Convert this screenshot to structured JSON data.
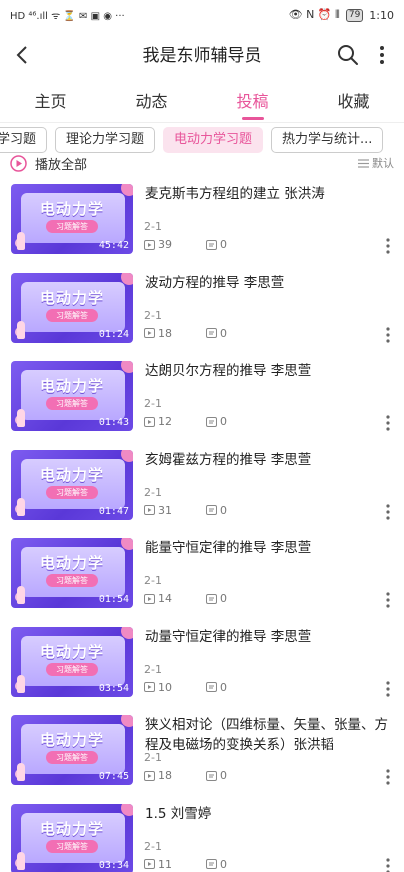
{
  "status_bar": {
    "left": "HD ⁴⁶.ıll ᯤ ⏳ ✉ ▣ ◉ ···",
    "right_icons": "👁 N ⏰ ⦀",
    "battery": "79",
    "time": "1:10"
  },
  "header": {
    "title": "我是东师辅导员"
  },
  "tabs": [
    {
      "label": "主页",
      "active": false
    },
    {
      "label": "动态",
      "active": false
    },
    {
      "label": "投稿",
      "active": true
    },
    {
      "label": "收藏",
      "active": false
    }
  ],
  "chips": [
    {
      "label": "学习题",
      "active": false
    },
    {
      "label": "理论力学习题",
      "active": false
    },
    {
      "label": "电动力学习题",
      "active": true
    },
    {
      "label": "热力学与统计...",
      "active": false
    }
  ],
  "play_all": {
    "label": "播放全部",
    "sort_label": "默认"
  },
  "thumbnail": {
    "title": "电动力学",
    "badge": "习题解答"
  },
  "videos": [
    {
      "title": "麦克斯韦方程组的建立 张洪涛",
      "duration": "45:42",
      "episode": "2-1",
      "plays": "39",
      "comments": "0"
    },
    {
      "title": "波动方程的推导 李思萱",
      "duration": "01:24",
      "episode": "2-1",
      "plays": "18",
      "comments": "0"
    },
    {
      "title": "达朗贝尔方程的推导 李思萱",
      "duration": "01:43",
      "episode": "2-1",
      "plays": "12",
      "comments": "0"
    },
    {
      "title": "亥姆霍兹方程的推导 李思萱",
      "duration": "01:47",
      "episode": "2-1",
      "plays": "31",
      "comments": "0"
    },
    {
      "title": "能量守恒定律的推导 李思萱",
      "duration": "01:54",
      "episode": "2-1",
      "plays": "14",
      "comments": "0"
    },
    {
      "title": "动量守恒定律的推导 李思萱",
      "duration": "03:54",
      "episode": "2-1",
      "plays": "10",
      "comments": "0"
    },
    {
      "title": "狭义相对论（四维标量、矢量、张量、方程及电磁场的变换关系）张洪韬",
      "duration": "07:45",
      "episode": "2-1",
      "plays": "18",
      "comments": "0"
    },
    {
      "title": "1.5 刘雪婷",
      "duration": "03:34",
      "episode": "2-1",
      "plays": "11",
      "comments": "0"
    }
  ],
  "colors": {
    "accent": "#e8559a",
    "chip_active_bg": "#fbe3ee"
  }
}
